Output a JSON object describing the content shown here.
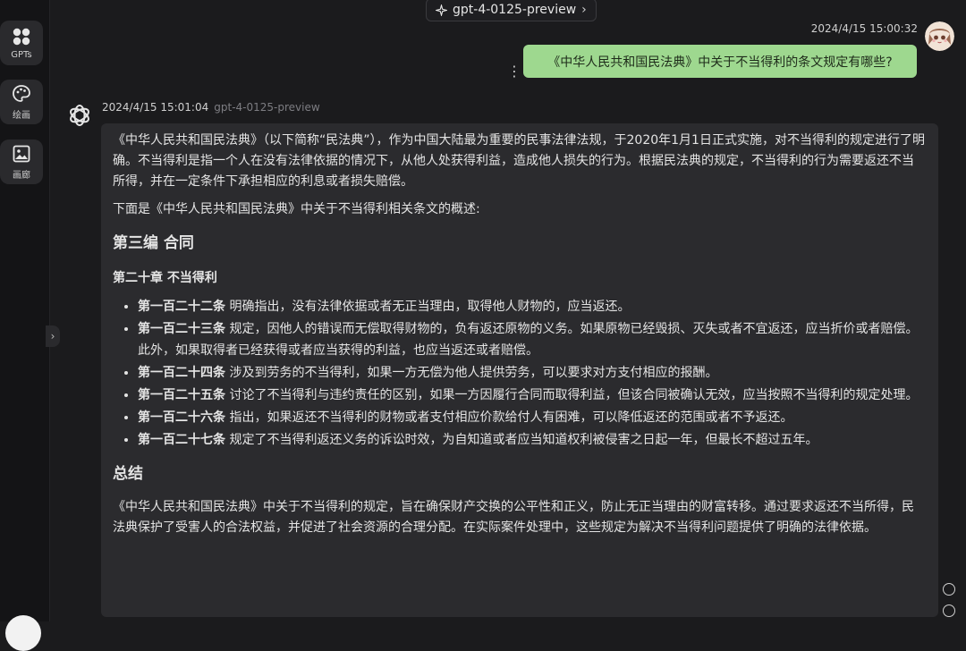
{
  "sidebar": {
    "items": [
      {
        "label": "GPTs",
        "icon": "grid-icon"
      },
      {
        "label": "绘画",
        "icon": "palette-icon"
      },
      {
        "label": "画廊",
        "icon": "image-icon"
      }
    ],
    "collapse_icon": "chevron-right-icon"
  },
  "header": {
    "model_label": "gpt-4-0125-preview",
    "model_icon": "sparkle-icon"
  },
  "user_message": {
    "time": "2024/4/15 15:00:32",
    "text": "《中华人民共和国民法典》中关于不当得利的条文规定有哪些?",
    "bubble_color": "#9ed88f"
  },
  "bot_message": {
    "time": "2024/4/15 15:01:04",
    "model": "gpt-4-0125-preview",
    "para1": "《中华人民共和国民法典》（以下简称“民法典”），作为中国大陆最为重要的民事法律法规，于2020年1月1日正式实施，对不当得利的规定进行了明确。不当得利是指一个人在没有法律依据的情况下，从他人处获得利益，造成他人损失的行为。根据民法典的规定，不当得利的行为需要返还不当所得，并在一定条件下承担相应的利息或者损失赔偿。",
    "para2": "下面是《中华人民共和国民法典》中关于不当得利相关条文的概述:",
    "section": "第三编 合同",
    "chapter": "第二十章 不当得利",
    "articles": [
      {
        "title": "第一百二十二条",
        "text": " 明确指出，没有法律依据或者无正当理由，取得他人财物的，应当返还。"
      },
      {
        "title": "第一百二十三条",
        "text": " 规定，因他人的错误而无偿取得财物的，负有返还原物的义务。如果原物已经毁损、灭失或者不宜返还，应当折价或者赔偿。此外，如果取得者已经获得或者应当获得的利益，也应当返还或者赔偿。"
      },
      {
        "title": "第一百二十四条",
        "text": " 涉及到劳务的不当得利，如果一方无偿为他人提供劳务，可以要求对方支付相应的报酬。"
      },
      {
        "title": "第一百二十五条",
        "text": " 讨论了不当得利与违约责任的区别，如果一方因履行合同而取得利益，但该合同被确认无效，应当按照不当得利的规定处理。"
      },
      {
        "title": "第一百二十六条",
        "text": " 指出，如果返还不当得利的财物或者支付相应价款给付人有困难，可以降低返还的范围或者不予返还。"
      },
      {
        "title": "第一百二十七条",
        "text": " 规定了不当得利返还义务的诉讼时效，为自知道或者应当知道权利被侵害之日起一年，但最长不超过五年。"
      }
    ],
    "summary_heading": "总结",
    "summary": "《中华人民共和国民法典》中关于不当得利的规定，旨在确保财产交换的公平性和正义，防止无正当理由的财富转移。通过要求返还不当所得，民法典保护了受害人的合法权益，并促进了社会资源的合理分配。在实际案件处理中，这些规定为解决不当得利问题提供了明确的法律依据。"
  }
}
